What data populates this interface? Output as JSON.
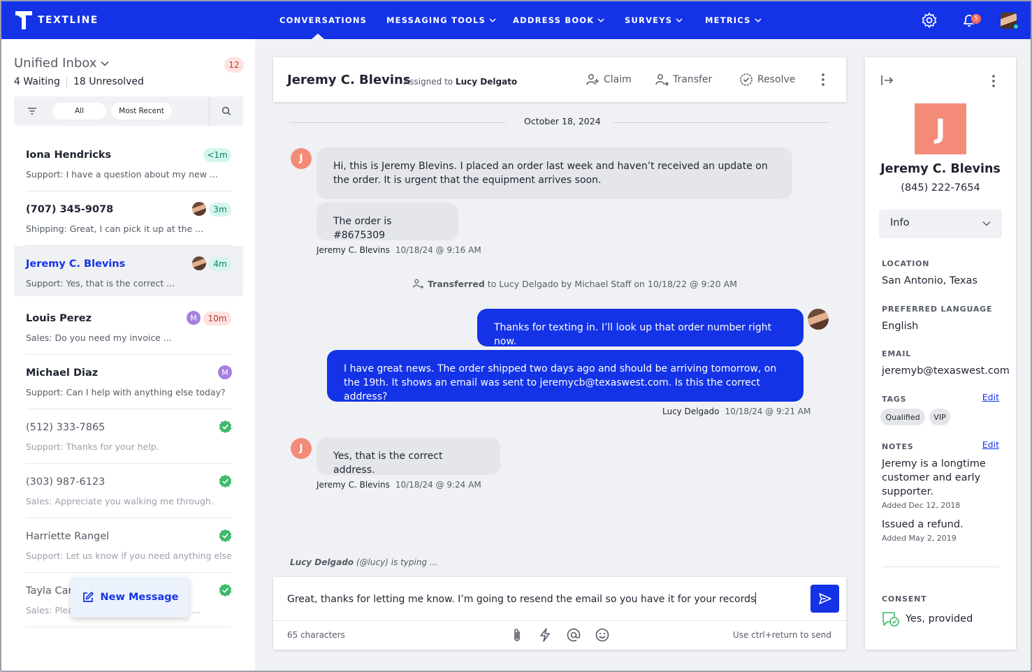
{
  "nav": {
    "brand": "TEXTLINE",
    "items": [
      {
        "label": "CONVERSATIONS",
        "dropdown": false
      },
      {
        "label": "MESSAGING TOOLS",
        "dropdown": true
      },
      {
        "label": "ADDRESS BOOK",
        "dropdown": true
      },
      {
        "label": "SURVEYS",
        "dropdown": true
      },
      {
        "label": "METRICS",
        "dropdown": true
      }
    ],
    "notification_count": "5",
    "icons": [
      "settings-gear-icon",
      "bell-icon",
      "user-avatar"
    ]
  },
  "inbox": {
    "title": "Unified Inbox",
    "count": "12",
    "waiting_num": "4",
    "waiting_label": "Waiting",
    "unresolved_num": "18",
    "unresolved_label": "Unresolved",
    "filter_all": "All",
    "filter_sort": "Most Recent"
  },
  "conversations": [
    {
      "name": "Iona Hendricks",
      "preview": "Support: I have a question about my new ...",
      "time": "<1m",
      "status": "waiting",
      "badge_color": "green"
    },
    {
      "name": "(707) 345-9078",
      "preview": "Shipping: Great, I can pick it up at the ...",
      "time": "3m",
      "status": "waiting",
      "badge_color": "green",
      "agent": "photo"
    },
    {
      "name": "Jeremy C. Blevins",
      "preview": "Support: Yes, that is the correct ...",
      "time": "4m",
      "status": "active",
      "badge_color": "green",
      "agent": "photo"
    },
    {
      "name": "Louis Perez",
      "preview": "Sales: Do you need my invoice ...",
      "time": "10m",
      "status": "waiting",
      "badge_color": "red",
      "agent_initial": "M"
    },
    {
      "name": "Michael Diaz",
      "preview": "Support: Can I help with anything else today?",
      "status": "open",
      "agent_initial": "M"
    },
    {
      "name": "(512) 333-7865",
      "preview": "Support: Thanks for your help.",
      "status": "resolved"
    },
    {
      "name": "(303) 987-6123",
      "preview": "Sales: Appreciate you walking me through.",
      "status": "resolved"
    },
    {
      "name": "Harriette Rangel",
      "preview": "Support: Let us know if you need anything else",
      "status": "resolved"
    },
    {
      "name": "Tayla Car",
      "preview": "Sales: Pleas",
      "preview_tail": "...",
      "status": "resolved"
    }
  ],
  "new_message_label": "New Message",
  "thread": {
    "contact_name": "Jeremy C. Blevins",
    "assigned_prefix": "Assigned to",
    "assigned_to": "Lucy Delgato",
    "actions": {
      "claim": "Claim",
      "transfer": "Transfer",
      "resolve": "Resolve"
    },
    "date": "October 18, 2024",
    "contact_initial": "J",
    "messages": {
      "in1": "Hi, this is Jeremy Blevins. I placed an order last week and haven’t received an update on the order. It is urgent that the equipment arrives soon.",
      "in2": "The order is #8675309",
      "in_meta1_name": "Jeremy C. Blevins",
      "in_meta1_time": "10/18/24 @ 9:16 AM",
      "transfer_bold": "Transferred",
      "transfer_rest": "to Lucy Delgado by Michael Staff on 10/18/22 @ 9:20 AM",
      "out1": "Thanks for texting in. I’ll look up that order number right now.",
      "out2": "I have great news. The order shipped two days ago and should be arriving tomorrow, on the 19th. It shows an email was sent to jeremycb@texaswest.com. Is this the correct address?",
      "out_meta_name": "Lucy Delgado",
      "out_meta_time": "10/18/24 @ 9:21 AM",
      "in3": "Yes, that is the correct address.",
      "in_meta2_name": "Jeremy C. Blevins",
      "in_meta2_time": "10/18/24 @ 9:24 AM"
    },
    "typing_name": "Lucy Delgado",
    "typing_rest": "(@lucy) is typing ..."
  },
  "composer": {
    "text": "Great, thanks for letting me know. I’m going to resend the email so you have it for your records",
    "char_count": "65 characters",
    "hint": "Use ctrl+return to send",
    "tools": [
      "attachment-icon",
      "lightning-icon",
      "mention-icon",
      "emoji-icon"
    ]
  },
  "profile": {
    "initial": "J",
    "name": "Jeremy C. Blevins",
    "phone": "(845) 222-7654",
    "section_select": "Info",
    "location_label": "LOCATION",
    "location": "San Antonio, Texas",
    "language_label": "PREFERRED LANGUAGE",
    "language": "English",
    "email_label": "EMAIL",
    "email": "jeremyb@texaswest.com",
    "tags_label": "TAGS",
    "tags": [
      "Qualified",
      "VIP"
    ],
    "edit_label": "Edit",
    "notes_label": "NOTES",
    "notes": [
      {
        "text": "Jeremy is a longtime customer and early supporter.",
        "added": "Added Dec 12, 2018"
      },
      {
        "text": "Issued a refund.",
        "added": "Added May 2, 2019"
      }
    ],
    "consent_label": "CONSENT",
    "consent_value": "Yes, provided"
  },
  "colors": {
    "brand_blue": "#1433e6",
    "contact_avatar": "#f48b78",
    "resolved_green": "#3dba6a",
    "agent_purple": "#a77fe0"
  }
}
